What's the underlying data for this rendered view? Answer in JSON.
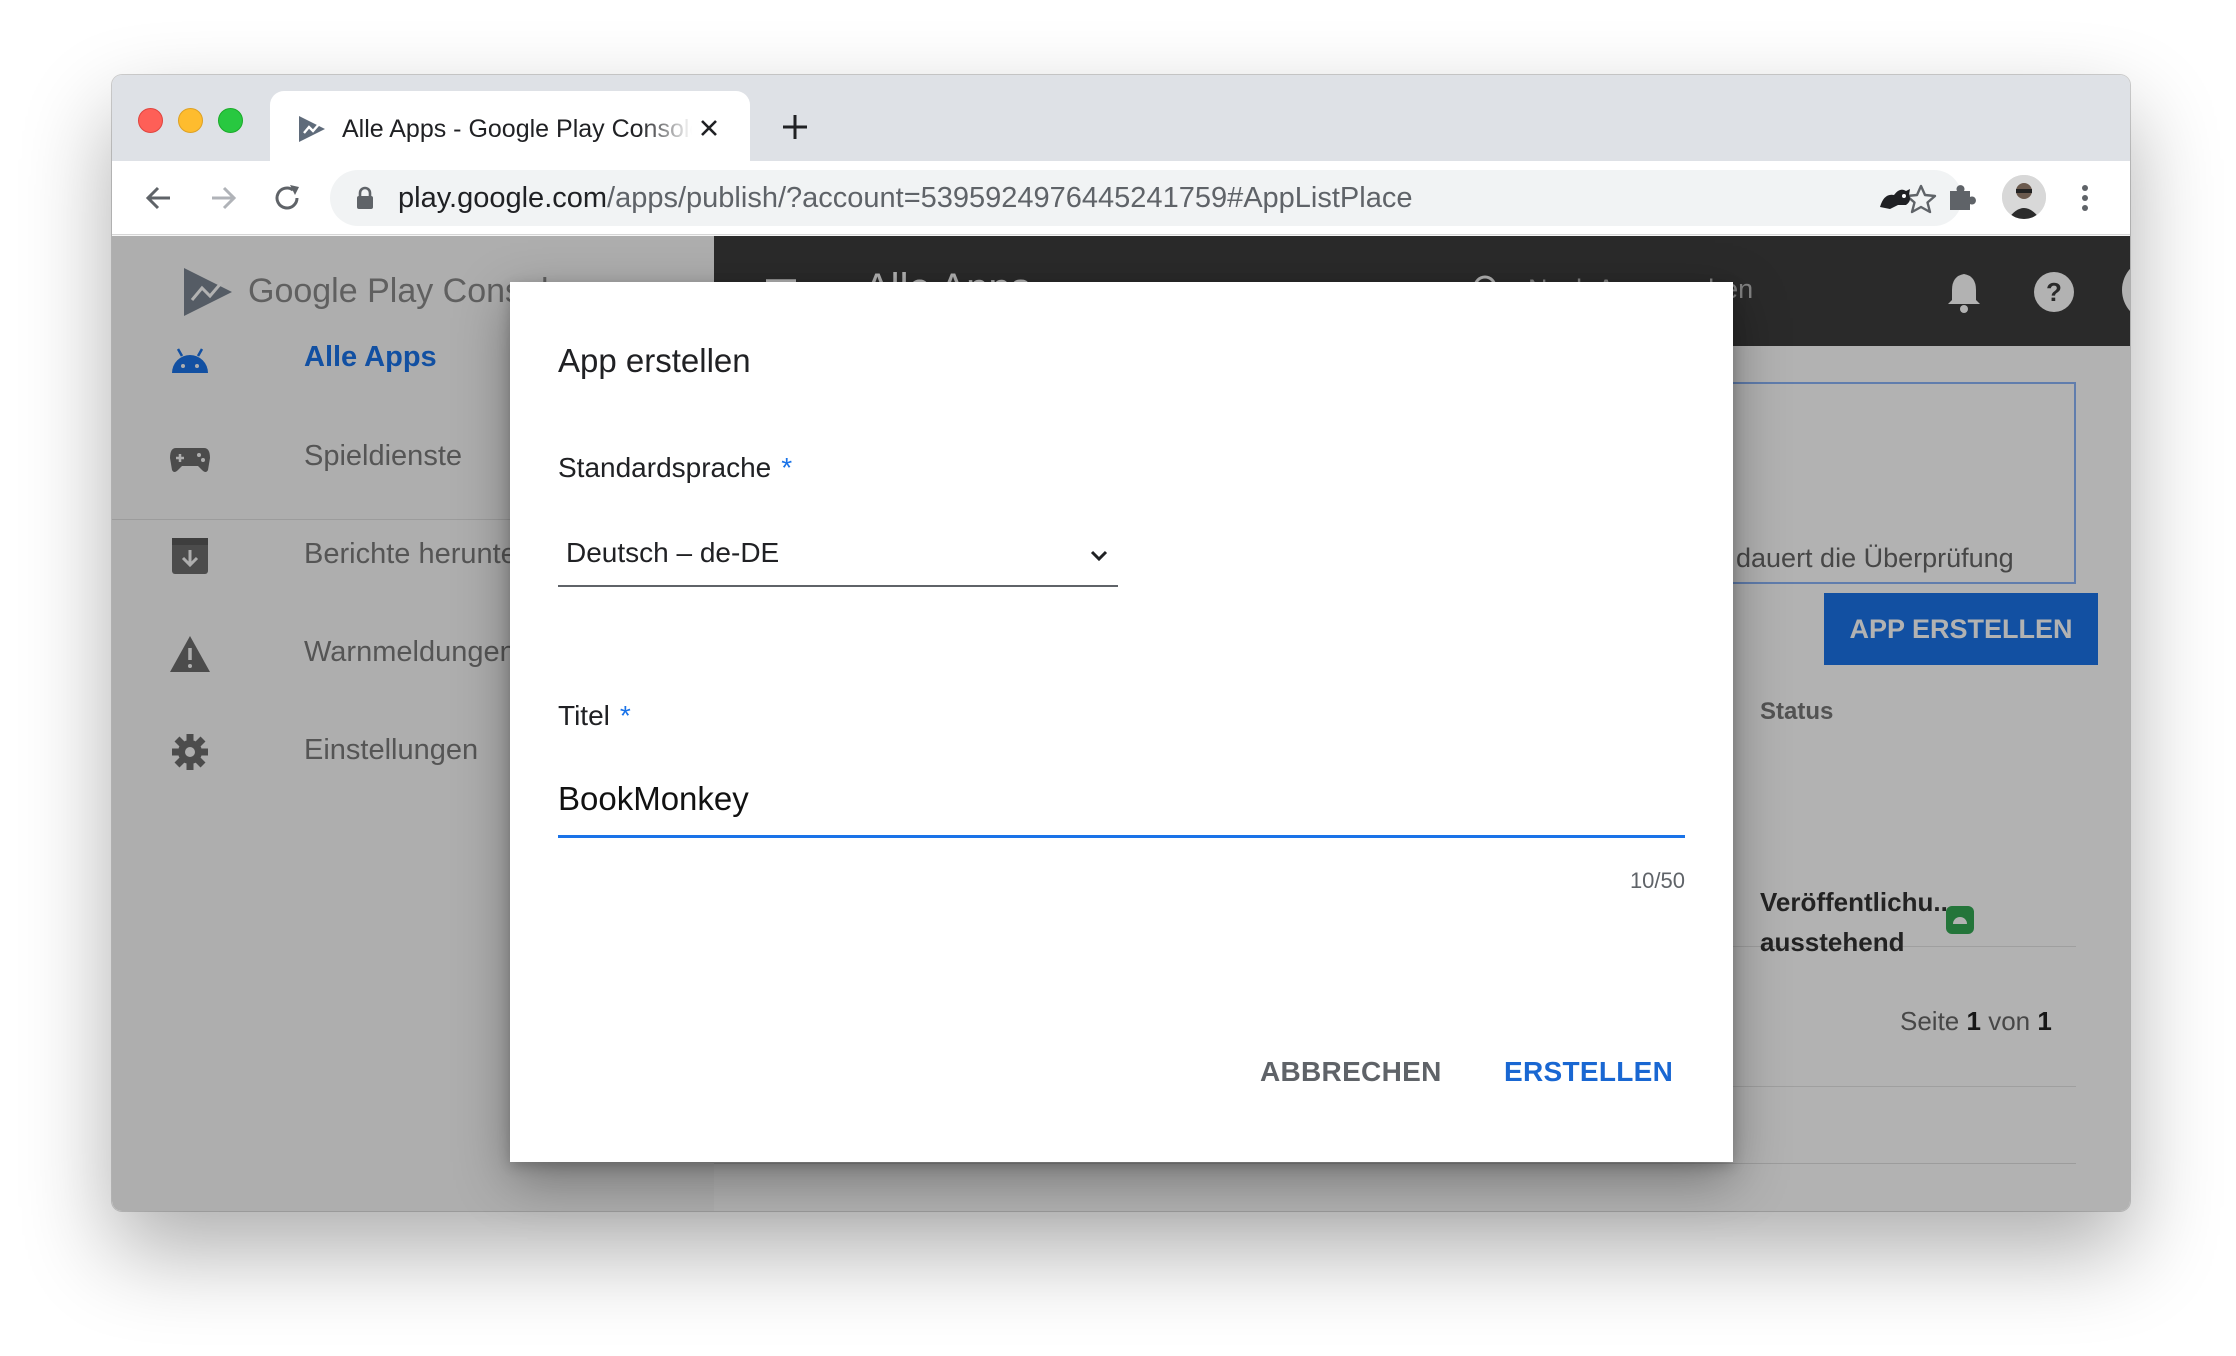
{
  "browser": {
    "tab_title": "Alle Apps - Google Play Console",
    "url_host": "play.google.com",
    "url_path": "/apps/publish/?account=5395924976445241759#AppListPlace"
  },
  "sidebar": {
    "brand": "Google Play Console",
    "items": [
      {
        "label": "Alle Apps",
        "icon": "android-icon"
      },
      {
        "label": "Spieldienste",
        "icon": "gamepad-icon"
      },
      {
        "label": "Berichte herunterladen",
        "icon": "download-icon"
      },
      {
        "label": "Warnmeldungen",
        "icon": "warning-icon"
      },
      {
        "label": "Einstellungen",
        "icon": "gear-icon"
      }
    ]
  },
  "header": {
    "title": "Alle Apps",
    "search_placeholder": "Nach Apps suchen"
  },
  "main": {
    "info_text": "dauert die Überprüfung",
    "create_app_button": "APP ERSTELLEN",
    "status_header": "Status",
    "status_value_line1": "Veröffentlichu...",
    "status_value_line2": "ausstehend",
    "pagination_prefix": "Seite",
    "pagination_page": "1",
    "pagination_of": "von",
    "pagination_total": "1"
  },
  "dialog": {
    "title": "App erstellen",
    "language_label": "Standardsprache",
    "language_value": "Deutsch – de-DE",
    "title_label": "Titel",
    "title_value": "BookMonkey",
    "char_counter": "10/50",
    "required_marker": "*",
    "cancel_label": "ABBRECHEN",
    "create_label": "ERSTELLEN"
  },
  "colors": {
    "accent": "#1a73e8",
    "header_dark": "#3d3d3d",
    "overlay": "rgba(0,0,0,0.30)"
  }
}
